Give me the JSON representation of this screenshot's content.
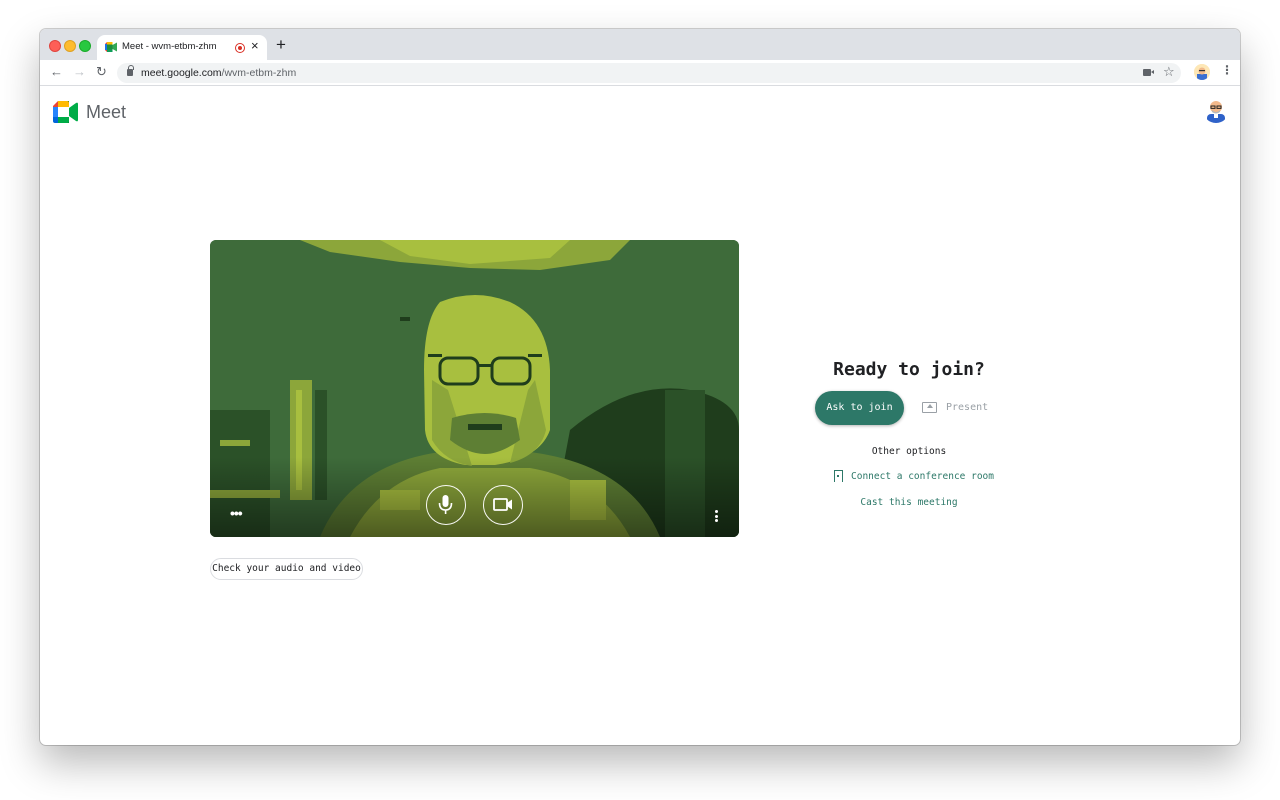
{
  "browser": {
    "tab": {
      "title": "Meet - wvm-etbm-zhm",
      "favicon": "meet-favicon",
      "recording_indicator": true,
      "close_symbol": "×"
    },
    "new_tab_symbol": "+",
    "nav": {
      "back": "←",
      "forward": "→",
      "reload": "↻"
    },
    "address": {
      "host": "meet.google.com",
      "path": "/wvm-etbm-zhm"
    },
    "star_symbol": "☆",
    "menu_symbol": "⋮"
  },
  "meet": {
    "product_name": "Meet",
    "check_audio_video_label": "Check your audio and video",
    "join": {
      "heading": "Ready to join?",
      "ask_to_join_label": "Ask to join",
      "present_label": "Present",
      "other_options_label": "Other options",
      "connect_room_label": "Connect a conference room",
      "cast_label": "Cast this meeting"
    },
    "preview_controls": {
      "mic_icon": "microphone-icon",
      "camera_icon": "camera-icon",
      "more_horizontal": "•••"
    }
  },
  "colors": {
    "accent": "#2d7868",
    "preview_dark": "#3e6b3a",
    "preview_mid": "#8ca63a",
    "preview_light": "#a8bf3f",
    "preview_shadow": "#1f3d1c"
  }
}
